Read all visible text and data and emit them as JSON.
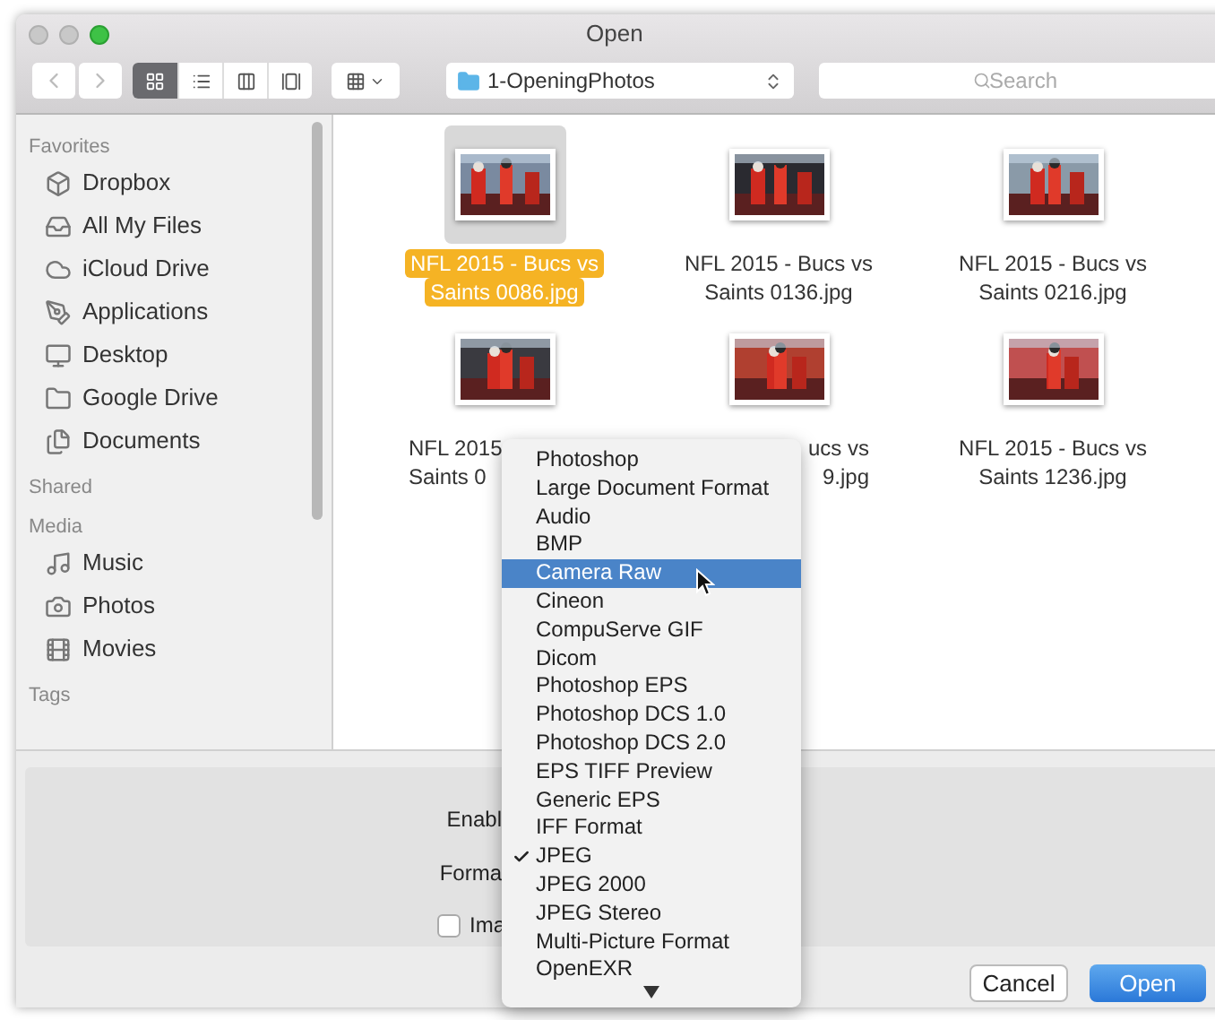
{
  "window": {
    "title": "Open"
  },
  "toolbar": {
    "views": [
      {
        "kind": "icons",
        "selected": true
      },
      {
        "kind": "list",
        "selected": false
      },
      {
        "kind": "columns",
        "selected": false
      },
      {
        "kind": "coverflow",
        "selected": false
      }
    ],
    "location": "1-OpeningPhotos",
    "search": {
      "placeholder": "Search"
    }
  },
  "sidebar": {
    "sections": [
      {
        "title": "Favorites",
        "items": [
          {
            "label": "Dropbox"
          },
          {
            "label": "All My Files"
          },
          {
            "label": "iCloud Drive"
          },
          {
            "label": "Applications"
          },
          {
            "label": "Desktop"
          },
          {
            "label": "Google Drive"
          },
          {
            "label": "Documents"
          }
        ]
      },
      {
        "title": "Shared"
      },
      {
        "title": "Media",
        "items": [
          {
            "label": "Music"
          },
          {
            "label": "Photos"
          },
          {
            "label": "Movies"
          }
        ]
      },
      {
        "title": "Tags"
      }
    ]
  },
  "files": [
    {
      "lines": [
        "NFL 2015 - Bucs vs",
        "Saints 0086.jpg"
      ],
      "selected": true,
      "kind": "full"
    },
    {
      "lines": [
        "NFL 2015 - Bucs vs",
        "Saints 0136.jpg"
      ],
      "selected": false,
      "kind": "full"
    },
    {
      "lines": [
        "NFL 2015 - Bucs vs",
        "Saints 0216.jpg"
      ],
      "selected": false,
      "kind": "full"
    },
    {
      "lines": [
        "NFL 2015",
        "Saints 0"
      ],
      "selected": false,
      "kind": "left"
    },
    {
      "lines": [
        "ucs vs",
        "9.jpg"
      ],
      "selected": false,
      "kind": "right"
    },
    {
      "lines": [
        "NFL 2015 - Bucs vs",
        "Saints 1236.jpg"
      ],
      "selected": false,
      "kind": "full"
    }
  ],
  "options": [
    {
      "kind": "label",
      "label": "Enabl"
    },
    {
      "kind": "label",
      "label": "Forma"
    },
    {
      "kind": "checkbox",
      "label": "Ima",
      "checked": false
    }
  ],
  "format_menu": {
    "items": [
      {
        "label": "Photoshop",
        "selected": false,
        "checked": false
      },
      {
        "label": "Large Document Format",
        "selected": false,
        "checked": false
      },
      {
        "label": "Audio",
        "selected": false,
        "checked": false
      },
      {
        "label": "BMP",
        "selected": false,
        "checked": false
      },
      {
        "label": "Camera Raw",
        "selected": true,
        "checked": false
      },
      {
        "label": "Cineon",
        "selected": false,
        "checked": false
      },
      {
        "label": "CompuServe GIF",
        "selected": false,
        "checked": false
      },
      {
        "label": "Dicom",
        "selected": false,
        "checked": false
      },
      {
        "label": "Photoshop EPS",
        "selected": false,
        "checked": false
      },
      {
        "label": "Photoshop DCS 1.0",
        "selected": false,
        "checked": false
      },
      {
        "label": "Photoshop DCS 2.0",
        "selected": false,
        "checked": false
      },
      {
        "label": "EPS TIFF Preview",
        "selected": false,
        "checked": false
      },
      {
        "label": "Generic EPS",
        "selected": false,
        "checked": false
      },
      {
        "label": "IFF Format",
        "selected": false,
        "checked": false
      },
      {
        "label": "JPEG",
        "selected": false,
        "checked": true
      },
      {
        "label": "JPEG 2000",
        "selected": false,
        "checked": false
      },
      {
        "label": "JPEG Stereo",
        "selected": false,
        "checked": false
      },
      {
        "label": "Multi-Picture Format",
        "selected": false,
        "checked": false
      },
      {
        "label": "OpenEXR",
        "selected": false,
        "checked": false
      }
    ]
  },
  "buttons": [
    {
      "label": "Cancel",
      "kind": "secondary"
    },
    {
      "label": "Open",
      "kind": "primary"
    }
  ]
}
